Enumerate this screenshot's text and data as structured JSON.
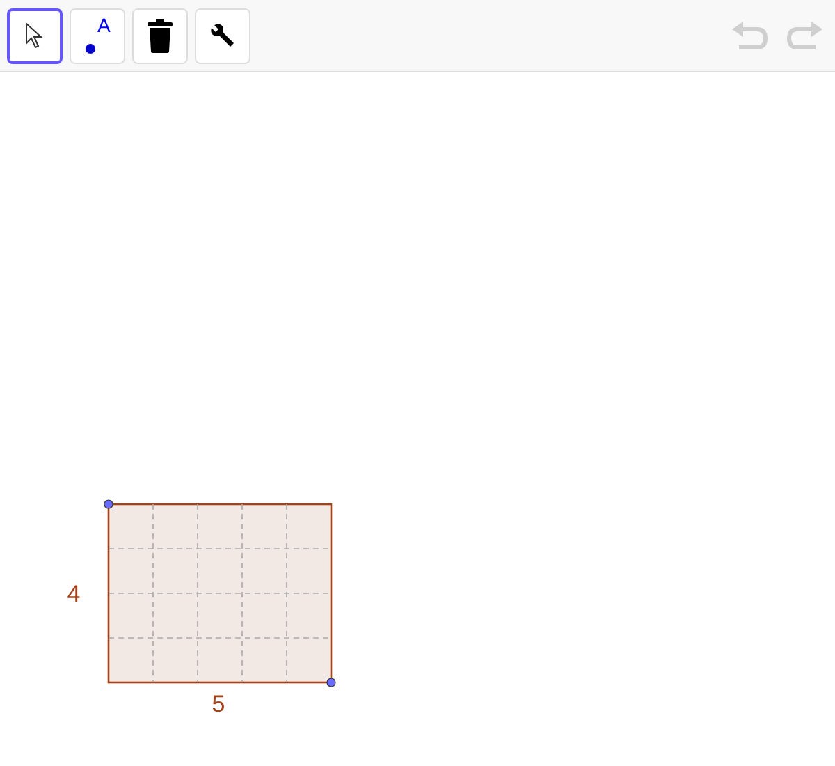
{
  "toolbar": {
    "tools": [
      {
        "kind": "move",
        "selected": true
      },
      {
        "kind": "point",
        "selected": false,
        "label": "A"
      },
      {
        "kind": "delete",
        "selected": false
      },
      {
        "kind": "settings",
        "selected": false
      }
    ],
    "history": [
      {
        "kind": "undo",
        "disabled": true
      },
      {
        "kind": "redo",
        "disabled": true
      }
    ]
  },
  "canvas": {
    "rectangle": {
      "width_label": "5",
      "height_label": "4"
    }
  }
}
